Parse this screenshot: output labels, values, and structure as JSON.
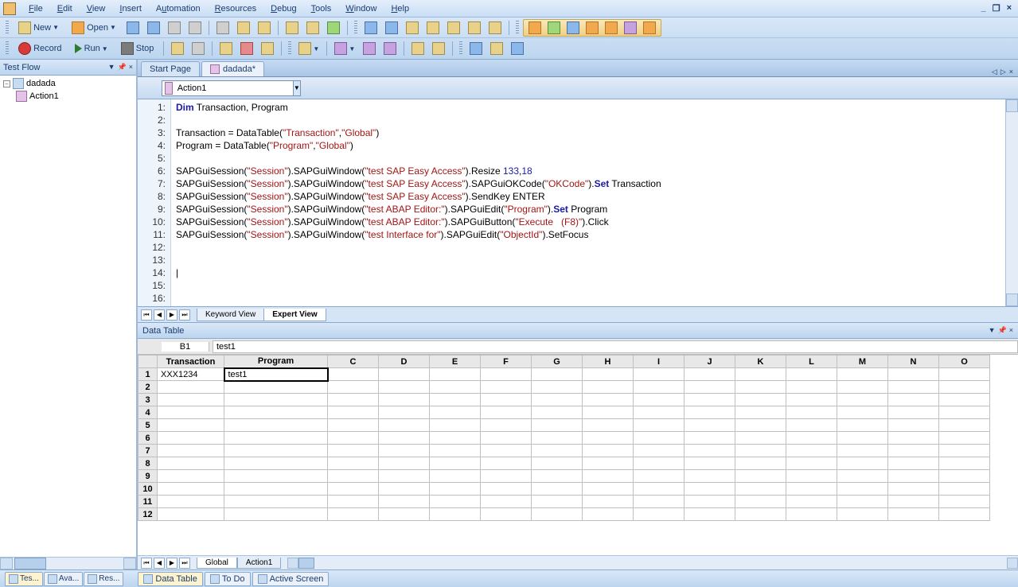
{
  "menus": {
    "file": "File",
    "edit": "Edit",
    "view": "View",
    "insert": "Insert",
    "automation": "Automation",
    "resources": "Resources",
    "debug": "Debug",
    "tools": "Tools",
    "window": "Window",
    "help": "Help"
  },
  "toolbar": {
    "new": "New",
    "open": "Open",
    "record": "Record",
    "run": "Run",
    "stop": "Stop"
  },
  "left_panel": {
    "title": "Test Flow",
    "tree": [
      {
        "label": "dadada",
        "expanded": true
      },
      {
        "label": "Action1",
        "indent": 1
      }
    ],
    "bottom_tabs": [
      {
        "label": "Tes...",
        "active": true
      },
      {
        "label": "Ava..."
      },
      {
        "label": "Res..."
      }
    ]
  },
  "doc_tabs": [
    {
      "label": "Start Page",
      "active": false
    },
    {
      "label": "dadada*",
      "active": true
    }
  ],
  "action_selected": "Action1",
  "code": {
    "lines": [
      {
        "n": 1,
        "html": "<span class='kw'>Dim</span> Transaction, Program"
      },
      {
        "n": 2,
        "html": ""
      },
      {
        "n": 3,
        "html": "Transaction = DataTable(<span class='str'>\"Transaction\"</span>,<span class='str'>\"Global\"</span>)"
      },
      {
        "n": 4,
        "html": "Program = DataTable(<span class='str'>\"Program\"</span>,<span class='str'>\"Global\"</span>)"
      },
      {
        "n": 5,
        "html": ""
      },
      {
        "n": 6,
        "html": "SAPGuiSession(<span class='str'>\"Session\"</span>).SAPGuiWindow(<span class='str'>\"test SAP Easy Access\"</span>).Resize <span class='num'>133</span>,<span class='num'>18</span>"
      },
      {
        "n": 7,
        "html": "SAPGuiSession(<span class='str'>\"Session\"</span>).SAPGuiWindow(<span class='str'>\"test SAP Easy Access\"</span>).SAPGuiOKCode(<span class='str'>\"OKCode\"</span>).<span class='kw'>Set</span> Transaction"
      },
      {
        "n": 8,
        "html": "SAPGuiSession(<span class='str'>\"Session\"</span>).SAPGuiWindow(<span class='str'>\"test SAP Easy Access\"</span>).SendKey ENTER"
      },
      {
        "n": 9,
        "html": "SAPGuiSession(<span class='str'>\"Session\"</span>).SAPGuiWindow(<span class='str'>\"test ABAP Editor:\"</span>).SAPGuiEdit(<span class='str'>\"Program\"</span>).<span class='kw'>Set</span> Program"
      },
      {
        "n": 10,
        "html": "SAPGuiSession(<span class='str'>\"Session\"</span>).SAPGuiWindow(<span class='str'>\"test ABAP Editor:\"</span>).SAPGuiButton(<span class='str'>\"Execute   (F8)\"</span>).Click"
      },
      {
        "n": 11,
        "html": "SAPGuiSession(<span class='str'>\"Session\"</span>).SAPGuiWindow(<span class='str'>\"test Interface for\"</span>).SAPGuiEdit(<span class='str'>\"ObjectId\"</span>).SetFocus"
      },
      {
        "n": 12,
        "html": ""
      },
      {
        "n": 13,
        "html": ""
      },
      {
        "n": 14,
        "html": "|"
      },
      {
        "n": 15,
        "html": ""
      },
      {
        "n": 16,
        "html": ""
      }
    ]
  },
  "view_tabs": {
    "keyword": "Keyword View",
    "expert": "Expert View"
  },
  "datatable": {
    "title": "Data Table",
    "cell_ref": "B1",
    "formula": "test1",
    "columns": [
      "Transaction",
      "Program",
      "C",
      "D",
      "E",
      "F",
      "G",
      "H",
      "I",
      "J",
      "K",
      "L",
      "M",
      "N",
      "O"
    ],
    "rows": [
      {
        "n": 1,
        "cells": [
          "XXX1234",
          "test1",
          "",
          "",
          "",
          "",
          "",
          "",
          "",
          "",
          "",
          "",
          "",
          "",
          ""
        ]
      },
      {
        "n": 2,
        "cells": [
          "",
          "",
          "",
          "",
          "",
          "",
          "",
          "",
          "",
          "",
          "",
          "",
          "",
          "",
          ""
        ]
      },
      {
        "n": 3,
        "cells": [
          "",
          "",
          "",
          "",
          "",
          "",
          "",
          "",
          "",
          "",
          "",
          "",
          "",
          "",
          ""
        ]
      },
      {
        "n": 4,
        "cells": [
          "",
          "",
          "",
          "",
          "",
          "",
          "",
          "",
          "",
          "",
          "",
          "",
          "",
          "",
          ""
        ]
      },
      {
        "n": 5,
        "cells": [
          "",
          "",
          "",
          "",
          "",
          "",
          "",
          "",
          "",
          "",
          "",
          "",
          "",
          "",
          ""
        ]
      },
      {
        "n": 6,
        "cells": [
          "",
          "",
          "",
          "",
          "",
          "",
          "",
          "",
          "",
          "",
          "",
          "",
          "",
          "",
          ""
        ]
      },
      {
        "n": 7,
        "cells": [
          "",
          "",
          "",
          "",
          "",
          "",
          "",
          "",
          "",
          "",
          "",
          "",
          "",
          "",
          ""
        ]
      },
      {
        "n": 8,
        "cells": [
          "",
          "",
          "",
          "",
          "",
          "",
          "",
          "",
          "",
          "",
          "",
          "",
          "",
          "",
          ""
        ]
      },
      {
        "n": 9,
        "cells": [
          "",
          "",
          "",
          "",
          "",
          "",
          "",
          "",
          "",
          "",
          "",
          "",
          "",
          "",
          ""
        ]
      },
      {
        "n": 10,
        "cells": [
          "",
          "",
          "",
          "",
          "",
          "",
          "",
          "",
          "",
          "",
          "",
          "",
          "",
          "",
          ""
        ]
      },
      {
        "n": 11,
        "cells": [
          "",
          "",
          "",
          "",
          "",
          "",
          "",
          "",
          "",
          "",
          "",
          "",
          "",
          "",
          ""
        ]
      },
      {
        "n": 12,
        "cells": [
          "",
          "",
          "",
          "",
          "",
          "",
          "",
          "",
          "",
          "",
          "",
          "",
          "",
          "",
          ""
        ]
      }
    ],
    "sheets": [
      {
        "label": "Global",
        "active": true
      },
      {
        "label": "Action1",
        "active": false
      }
    ]
  },
  "bottom_tabs": [
    {
      "label": "Data Table",
      "active": true
    },
    {
      "label": "To Do",
      "active": false
    },
    {
      "label": "Active Screen",
      "active": false
    }
  ]
}
